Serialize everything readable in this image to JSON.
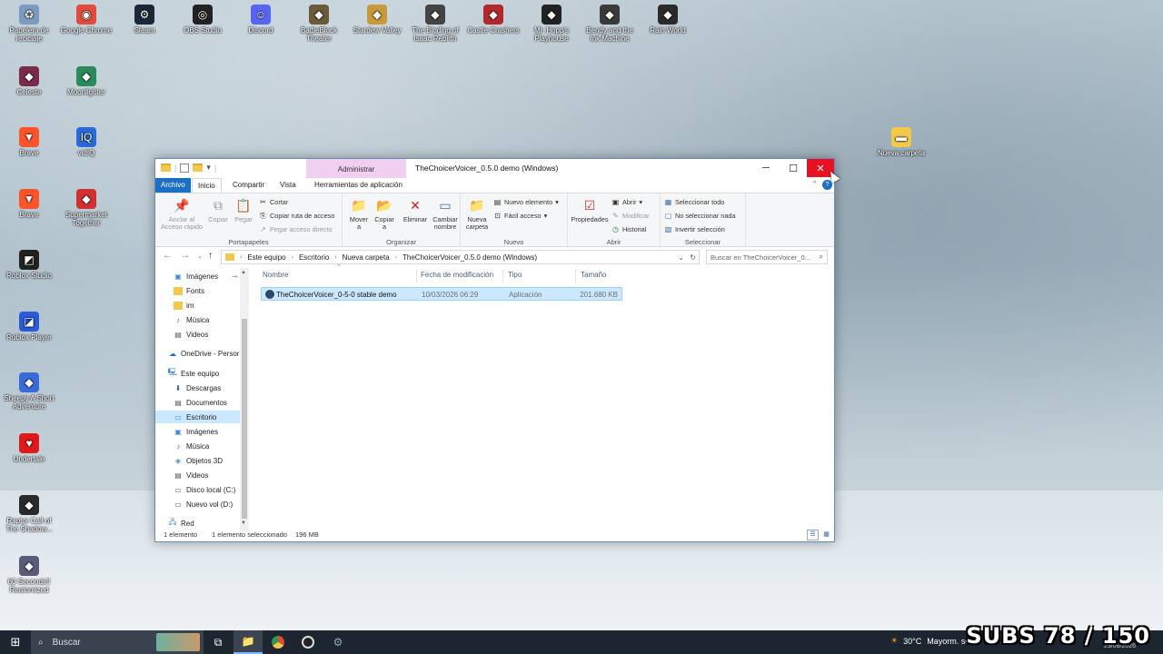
{
  "desktop": {
    "icons": [
      {
        "label": "Papelera de reciclaje",
        "icon": "recycle-bin-icon",
        "color": "#7a9cc0"
      },
      {
        "label": "Google Chrome",
        "icon": "chrome-icon",
        "color": "#e04b3b"
      },
      {
        "label": "Steam",
        "icon": "steam-icon",
        "color": "#1b2838"
      },
      {
        "label": "OBS Studio",
        "icon": "obs-icon",
        "color": "#222222"
      },
      {
        "label": "Discord",
        "icon": "discord-icon",
        "color": "#5865f2"
      },
      {
        "label": "BattleBlock Theater",
        "icon": "game-icon",
        "color": "#6b5a3a"
      },
      {
        "label": "Stardew Valley",
        "icon": "game-icon",
        "color": "#c89a3a"
      },
      {
        "label": "The Binding of Isaac Rebirth",
        "icon": "game-icon",
        "color": "#444444"
      },
      {
        "label": "Castle Crashers",
        "icon": "game-icon",
        "color": "#b3282d"
      },
      {
        "label": "Mr. Hopp's Playhouse",
        "icon": "game-icon",
        "color": "#222222"
      },
      {
        "label": "Bendy and the Ink Machine",
        "icon": "game-icon",
        "color": "#3a3a3a"
      },
      {
        "label": "Rain World",
        "icon": "game-icon",
        "color": "#2a2a2a"
      },
      {
        "label": "Celeste",
        "icon": "game-icon",
        "color": "#7a2a4a"
      },
      {
        "label": "Moonlighter",
        "icon": "game-icon",
        "color": "#2a8a5a"
      },
      {
        "label": "Brave",
        "icon": "brave-icon",
        "color": "#fb542b"
      },
      {
        "label": "vidIQ",
        "icon": "vidiq-icon",
        "color": "#2a6ad8"
      },
      {
        "label": "Brave",
        "icon": "brave-icon",
        "color": "#fb542b"
      },
      {
        "label": "Supermarket Together",
        "icon": "game-icon",
        "color": "#d03030"
      },
      {
        "label": "Roblox Studio",
        "icon": "roblox-studio-icon",
        "color": "#222222"
      },
      {
        "label": "Roblox Player",
        "icon": "roblox-icon",
        "color": "#2a5ad8"
      },
      {
        "label": "Sheepy A Short Adventure",
        "icon": "game-icon",
        "color": "#3a6ad8"
      },
      {
        "label": "Undertale",
        "icon": "undertale-icon",
        "color": "#e01a1a"
      },
      {
        "label": "Raptor Call of The Shadow...",
        "icon": "game-icon",
        "color": "#2a2a2a"
      },
      {
        "label": "60 Seconds!! Reatomized",
        "icon": "game-icon",
        "color": "#5a5a7a"
      },
      {
        "label": "Nueva carpeta",
        "icon": "folder-icon",
        "color": "#f2c94c"
      }
    ]
  },
  "window": {
    "title": "TheChoicerVoicer_0.5.0 demo (Windows)",
    "context_tab": "Administrar",
    "tabs": [
      "Archivo",
      "Inicio",
      "Compartir",
      "Vista",
      "Herramientas de aplicación"
    ],
    "ribbon": {
      "portapapeles": {
        "label": "Portapapeles",
        "pin": "Anclar al Acceso rápido",
        "copy": "Copiar",
        "paste": "Pegar",
        "cut": "Cortar",
        "copy_path": "Copiar ruta de acceso",
        "paste_shortcut": "Pegar acceso directo"
      },
      "organizar": {
        "label": "Organizar",
        "move": "Mover a",
        "copy_to": "Copiar a",
        "delete": "Eliminar",
        "rename": "Cambiar nombre"
      },
      "nuevo": {
        "label": "Nuevo",
        "new_folder": "Nueva carpeta",
        "new_item": "Nuevo elemento",
        "easy_access": "Fácil acceso"
      },
      "abrir": {
        "label": "Abrir",
        "properties": "Propiedades",
        "open": "Abrir",
        "edit": "Modificar",
        "history": "Historial"
      },
      "seleccionar": {
        "label": "Seleccionar",
        "select_all": "Seleccionar todo",
        "select_none": "No seleccionar nada",
        "invert": "Invertir selección"
      }
    },
    "address": {
      "crumbs": [
        "Este equipo",
        "Escritorio",
        "Nueva carpeta",
        "TheChoicerVoicer_0.5.0 demo (Windows)"
      ],
      "search_placeholder": "Buscar en TheChoicerVoicer_0..."
    },
    "nav": {
      "quick": [
        "Imágenes",
        "Fonts",
        "im",
        "Música",
        "Videos"
      ],
      "onedrive": "OneDrive - Persor",
      "this_pc": "Este equipo",
      "pc_items": [
        "Descargas",
        "Documentos",
        "Escritorio",
        "Imágenes",
        "Música",
        "Objetos 3D",
        "Videos",
        "Disco local (C:)",
        "Nuevo vol (D:)"
      ],
      "network": "Red"
    },
    "columns": [
      "Nombre",
      "Fecha de modificación",
      "Tipo",
      "Tamaño"
    ],
    "files": [
      {
        "name": "TheChoicerVoicer_0-5-0 stable demo",
        "date": "10/03/2026 06:29",
        "type": "Aplicación",
        "size": "201.680 KB"
      }
    ],
    "status": {
      "count": "1 elemento",
      "selected": "1 elemento seleccionado",
      "size": "196 MB"
    }
  },
  "taskbar": {
    "search": "Buscar",
    "weather_temp": "30°C",
    "weather_desc": "Mayorm. solea",
    "overlay": "SUBS 78 / 150",
    "date": "23/08/2026"
  }
}
